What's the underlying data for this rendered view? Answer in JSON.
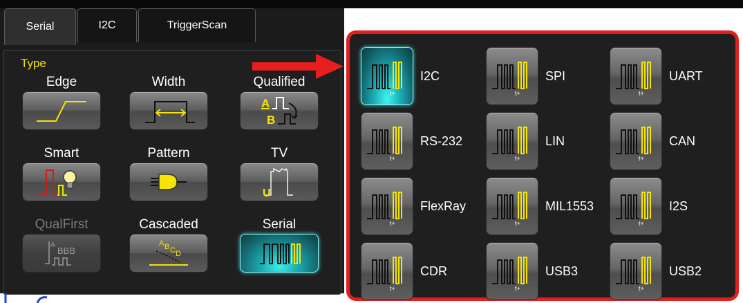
{
  "tabs": [
    {
      "label": "Serial",
      "active": true
    },
    {
      "label": "I2C",
      "active": false
    },
    {
      "label": "TriggerScan",
      "active": false
    }
  ],
  "type_label": "Type",
  "trigger_types": [
    {
      "label": "Edge",
      "icon": "edge-icon",
      "selected": false,
      "enabled": true
    },
    {
      "label": "Width",
      "icon": "width-icon",
      "selected": false,
      "enabled": true
    },
    {
      "label": "Qualified",
      "icon": "qualified-icon",
      "selected": false,
      "enabled": true
    },
    {
      "label": "Smart",
      "icon": "smart-icon",
      "selected": false,
      "enabled": true
    },
    {
      "label": "Pattern",
      "icon": "pattern-icon",
      "selected": false,
      "enabled": true
    },
    {
      "label": "TV",
      "icon": "tv-icon",
      "selected": false,
      "enabled": true
    },
    {
      "label": "QualFirst",
      "icon": "qualfirst-icon",
      "selected": false,
      "enabled": false
    },
    {
      "label": "Cascaded",
      "icon": "cascaded-icon",
      "selected": false,
      "enabled": true
    },
    {
      "label": "Serial",
      "icon": "serial-icon",
      "selected": true,
      "enabled": true
    }
  ],
  "protocols": [
    {
      "label": "I2C",
      "selected": true
    },
    {
      "label": "SPI",
      "selected": false
    },
    {
      "label": "UART",
      "selected": false
    },
    {
      "label": "RS-232",
      "selected": false
    },
    {
      "label": "LIN",
      "selected": false
    },
    {
      "label": "CAN",
      "selected": false
    },
    {
      "label": "FlexRay",
      "selected": false
    },
    {
      "label": "MIL1553",
      "selected": false
    },
    {
      "label": "I2S",
      "selected": false
    },
    {
      "label": "CDR",
      "selected": false
    },
    {
      "label": "USB3",
      "selected": false
    },
    {
      "label": "USB2",
      "selected": false
    }
  ],
  "colors": {
    "highlight_border": "#e61e1e",
    "type_label": "#f5e500",
    "selected_button": "#1cb0b8",
    "waveform_yellow": "#f5e500"
  }
}
